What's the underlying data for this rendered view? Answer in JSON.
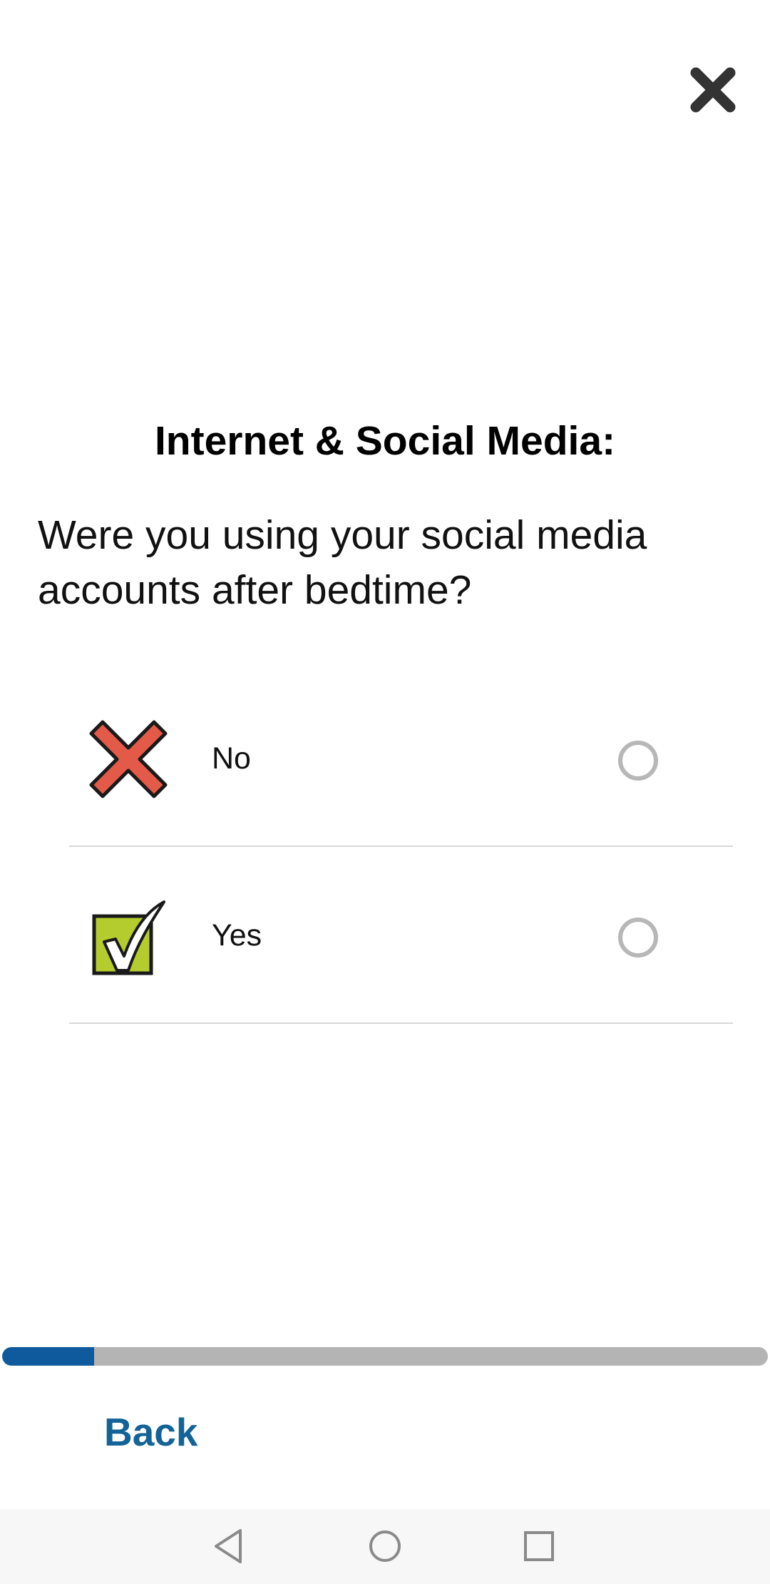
{
  "header": {
    "close_icon": "close-icon"
  },
  "survey": {
    "title": "Internet & Social Media:",
    "question": "Were you using your social media accounts after bedtime?",
    "options": [
      {
        "label": "No",
        "icon": "red-x-icon",
        "selected": false
      },
      {
        "label": "Yes",
        "icon": "green-checkbox-icon",
        "selected": false
      }
    ]
  },
  "progress": {
    "value": 0.12,
    "fill_color": "#0e5a9d",
    "track_color": "#b4b4b4"
  },
  "footer": {
    "back_label": "Back",
    "back_color": "#136397"
  },
  "system_nav": {
    "back_icon": "nav-back-icon",
    "home_icon": "nav-home-icon",
    "recents_icon": "nav-recents-icon"
  }
}
